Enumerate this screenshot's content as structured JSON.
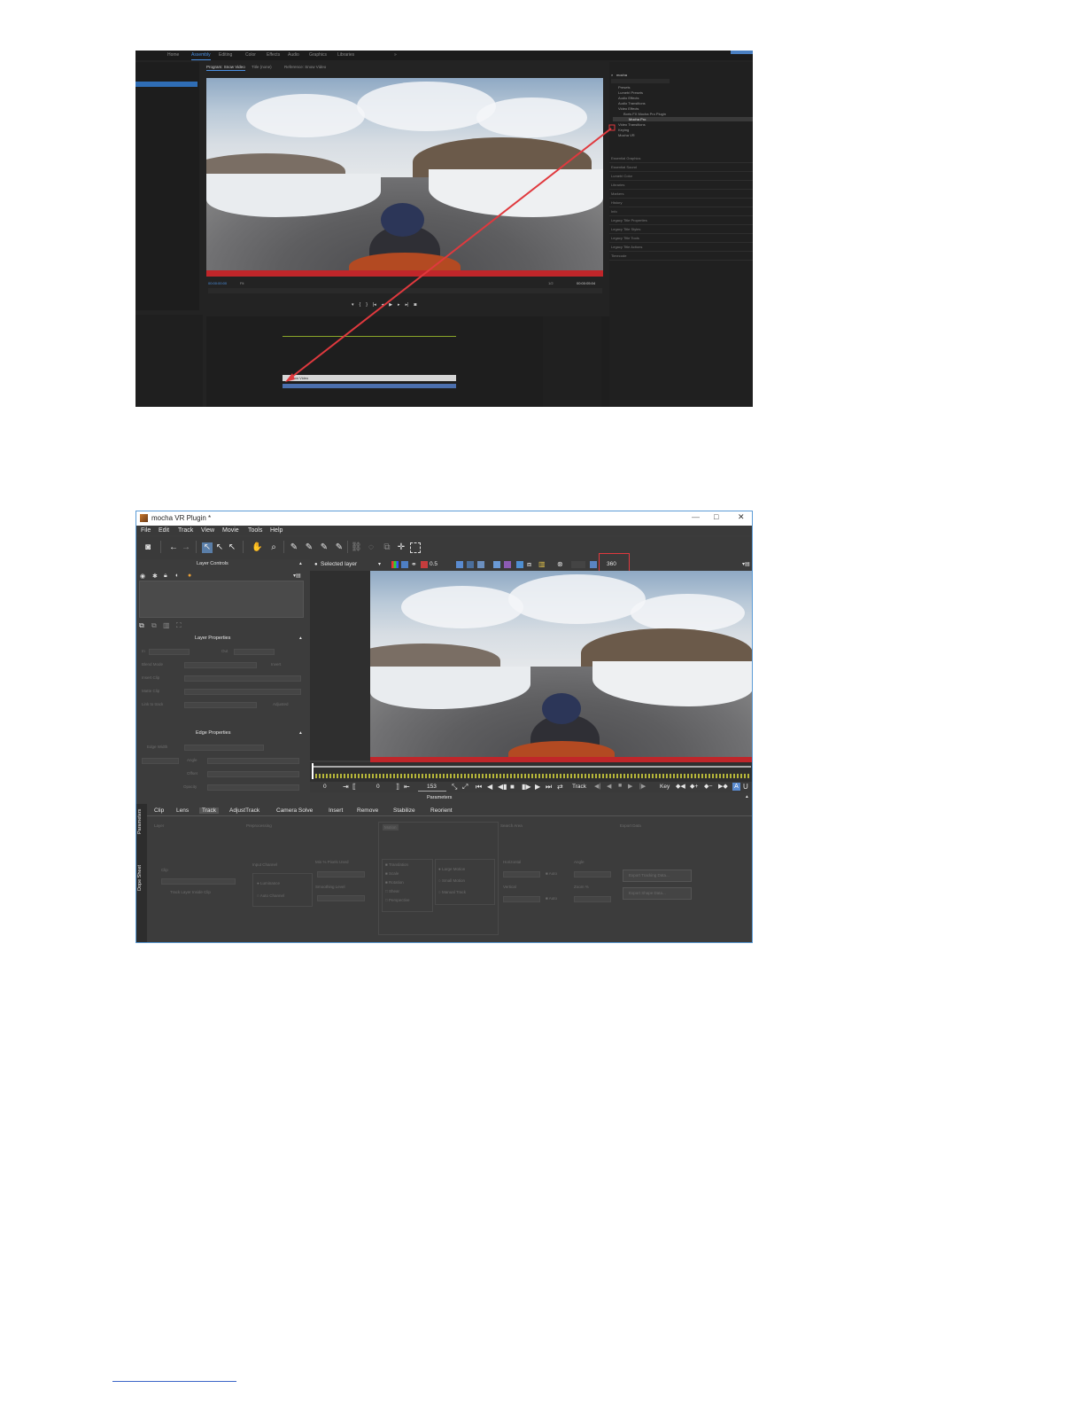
{
  "premiere": {
    "menu": [
      "Home",
      "Assembly",
      "Editing",
      "Color",
      "Effects",
      "Audio",
      "Graphics",
      "Libraries"
    ],
    "active_menu_index": 1,
    "program_tabs": [
      "Program: Snow Video",
      "Title (none)",
      "Reference: Snow Video"
    ],
    "timecode_left": "00:00:00:00",
    "timecode_right": "00:00:05:04",
    "fit_label": "Fit",
    "fraction_label": "1/2",
    "effects_search": "mocha",
    "effects_tree": [
      "Presets",
      "Lumetri Presets",
      "Audio Effects",
      "Audio Transitions",
      "Video Effects",
      "Boris FX Mocha Pro Plugin",
      "Mocha Pro",
      "Video Transitions",
      "Keying",
      "Mocha VR"
    ],
    "effects_sections": [
      "Essential Graphics",
      "Essential Sound",
      "Lumetri Color",
      "Libraries",
      "Markers",
      "History",
      "Info",
      "Legacy Title Properties",
      "Legacy Title Styles",
      "Legacy Title Tools",
      "Legacy Title Actions",
      "Timecode"
    ],
    "clip_label": "Snow Video"
  },
  "mocha": {
    "window_title": "mocha VR Plugin *",
    "window_controls": [
      "—",
      "□",
      "✕"
    ],
    "menu": [
      "File",
      "Edit",
      "Track",
      "View",
      "Movie",
      "Tools",
      "Help"
    ],
    "layer_controls": "Layer Controls",
    "layer_select": "Selected layer",
    "opacity": "0.5",
    "mode_360": "360",
    "layer_properties": "Layer Properties",
    "edge_properties": "Edge Properties",
    "layer_props_labels": [
      "In",
      "Out",
      "Blend Mode",
      "Insert Clip",
      "Matte Clip",
      "Link to track"
    ],
    "layer_props_right": [
      "Invert",
      "Adjusted"
    ],
    "edge_labels": [
      "Edge Width",
      "Angle",
      "Offset",
      "Opacity"
    ],
    "frame_in": "0",
    "frame_mid": "0",
    "frame_current": "153",
    "track_label": "Track",
    "key_label": "Key",
    "parameters_heading": "Parameters",
    "side_tabs": [
      "Parameters",
      "Dope Sheet"
    ],
    "bottom_tabs": [
      "Clip",
      "Lens",
      "Track",
      "AdjustTrack",
      "Camera Solve",
      "Insert",
      "Remove",
      "Stabilize",
      "Reorient"
    ],
    "active_bottom_tab": "Track",
    "param_sections": [
      "Layer",
      "Preprocessing",
      "Motion",
      "Search Area",
      "Export Data"
    ],
    "param_items_left": [
      "Clip",
      "Track Layer Inside Clip",
      "Input Channel",
      "Luminance",
      "Auto Channel",
      "Min % Pixels Used",
      "Smoothing Level"
    ],
    "param_items_motion": [
      "Translation",
      "Scale",
      "Rotation",
      "Shear",
      "Perspective",
      "Large Motion",
      "Small Motion",
      "Manual Track"
    ],
    "param_items_search": [
      "Horizontal",
      "Auto",
      "Vertical",
      "Auto",
      "Angle",
      "Zoom %"
    ],
    "export_buttons": [
      "Export Tracking Data...",
      "Export Shape Data..."
    ]
  },
  "colors": {
    "premiere_bg": "#232323",
    "mocha_bg": "#3c3c3c",
    "annotation_red": "#e0393e",
    "accent_blue": "#4a90e2"
  }
}
